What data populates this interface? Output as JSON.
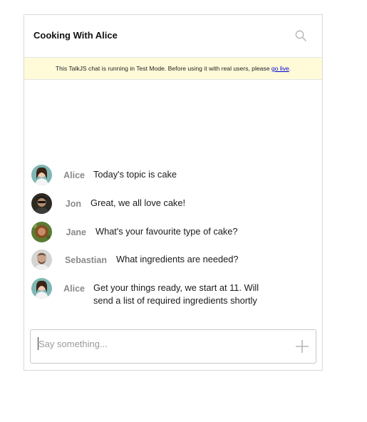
{
  "header": {
    "title": "Cooking With Alice",
    "search_icon": "search-icon"
  },
  "notice": {
    "text": "This TalkJS chat is running in Test Mode. Before using it with real users, please ",
    "link": "go live",
    "end": "."
  },
  "messages": [
    {
      "sender": "Alice",
      "text": "Today's topic is cake"
    },
    {
      "sender": "Jon",
      "text": "Great, we all love cake!"
    },
    {
      "sender": "Jane",
      "text": "What's your favourite type of cake?"
    },
    {
      "sender": "Sebastian",
      "text": "What ingredients are needed?"
    },
    {
      "sender": "Alice",
      "text": "Get your things ready, we start at 11. Will send a list of required ingredients shortly"
    }
  ],
  "composer": {
    "placeholder": "Say something...",
    "value": "",
    "add_icon": "plus-icon"
  },
  "colors": {
    "notice_bg": "#fffbd9",
    "sender_text": "#8a8a8a",
    "link": "#0000cc"
  }
}
